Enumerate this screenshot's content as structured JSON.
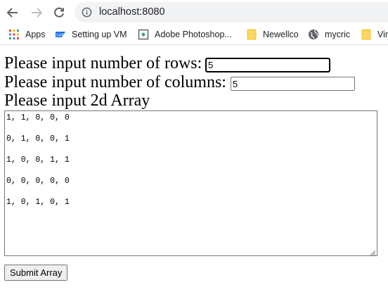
{
  "browser": {
    "url": "localhost:8080",
    "bookmarks": [
      {
        "label": "Apps",
        "icon": "apps-grid-icon"
      },
      {
        "label": "Setting up VM",
        "icon": "sap-icon"
      },
      {
        "label": "Adobe Photoshop...",
        "icon": "photoshop-icon"
      },
      {
        "label": "Newellco",
        "icon": "folder-icon"
      },
      {
        "label": "mycric",
        "icon": "globe-icon"
      },
      {
        "label": "Vir",
        "icon": "folder-icon"
      }
    ]
  },
  "form": {
    "rows_label": "Please input number of rows:",
    "rows_value": "5",
    "cols_label": "Please input number of columns:",
    "cols_value": "5",
    "array_label": "Please input 2d Array",
    "array_text": "1, 1, 0, 0, 0\n\n0, 1, 0, 0, 1\n\n1, 0, 0, 1, 1\n\n0, 0, 0, 0, 0\n\n1, 0, 1, 0, 1",
    "submit_label": "Submit Array"
  },
  "colors": {
    "folder": "#fdd663",
    "apps_dots": [
      "#ea4335",
      "#fbbc04",
      "#34a853",
      "#4285f4"
    ]
  }
}
